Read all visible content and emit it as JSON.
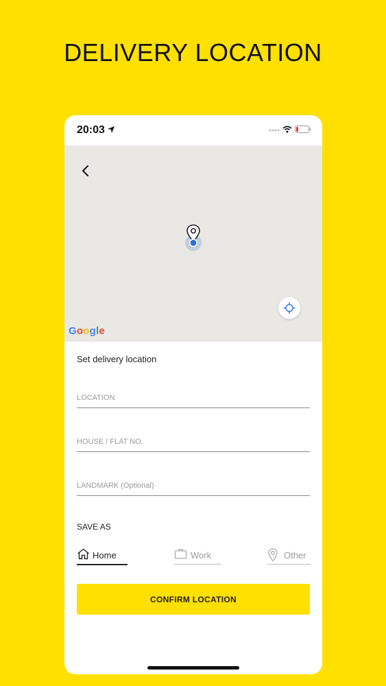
{
  "headline": "DELIVERY LOCATION",
  "status_bar": {
    "time": "20:03"
  },
  "map": {
    "attribution": "Google"
  },
  "form": {
    "title": "Set delivery location",
    "location_placeholder": "LOCATION",
    "house_placeholder": "HOUSE / FLAT NO.",
    "landmark_placeholder": "LANDMARK (Optional)",
    "save_as_label": "SAVE AS",
    "options": [
      {
        "label": "Home",
        "icon": "home-icon",
        "selected": true
      },
      {
        "label": "Work",
        "icon": "briefcase-icon",
        "selected": false
      },
      {
        "label": "Other",
        "icon": "location-pin-icon",
        "selected": false
      }
    ],
    "confirm_label": "CONFIRM LOCATION"
  },
  "colors": {
    "accent": "#FFE000",
    "map_bg": "#E9E8E4",
    "pin_blue": "#2F6FD8"
  }
}
